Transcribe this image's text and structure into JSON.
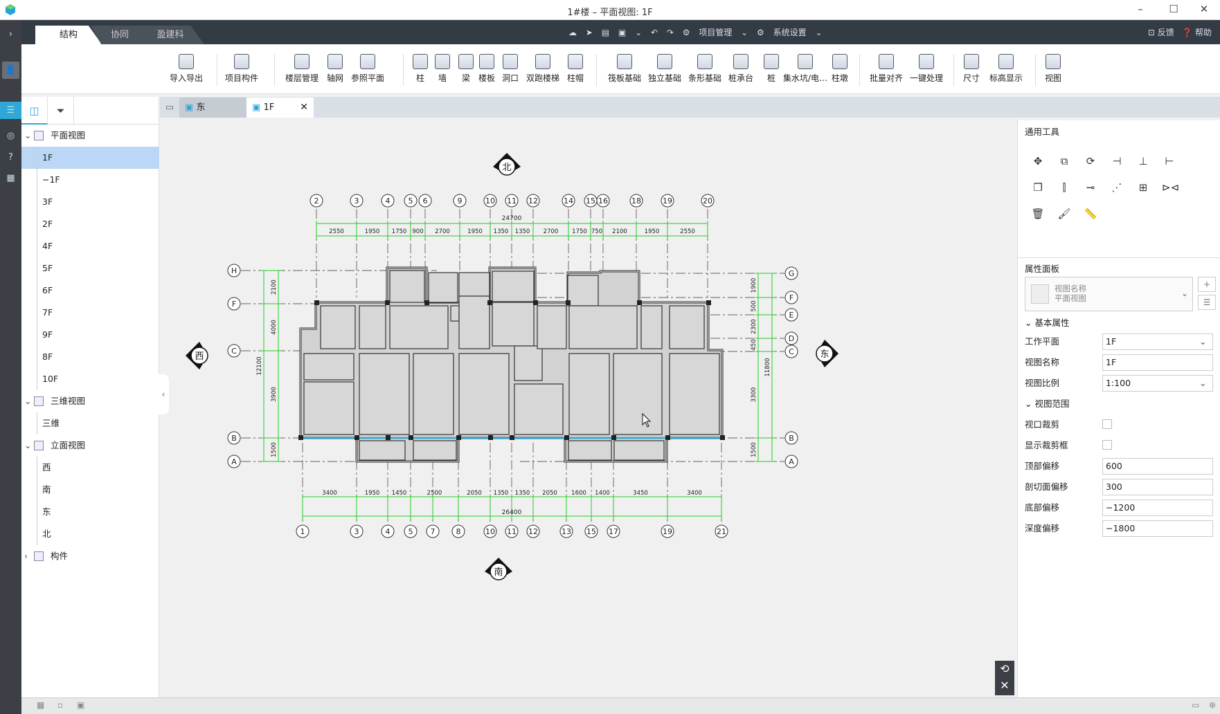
{
  "title": "1#楼 – 平面视图: 1F",
  "main_tabs": [
    "结构",
    "协同",
    "盈建科"
  ],
  "toolbar_center": [
    "项目管理",
    "系统设置"
  ],
  "toolbar_right": [
    "反馈",
    "帮助"
  ],
  "ribbon": [
    "导入导出",
    "项目构件",
    "楼层管理",
    "轴网",
    "参照平面",
    "柱",
    "墙",
    "梁",
    "楼板",
    "洞口",
    "双跑楼梯",
    "柱帽",
    "筏板基础",
    "独立基础",
    "条形基础",
    "桩承台",
    "桩",
    "集水坑/电…",
    "柱墩",
    "批量对齐",
    "一键处理",
    "尺寸",
    "标高显示",
    "视图"
  ],
  "tree": {
    "plan": "平面视图",
    "plan_items": [
      "1F",
      "−1F",
      "3F",
      "2F",
      "4F",
      "5F",
      "6F",
      "7F",
      "9F",
      "8F",
      "10F"
    ],
    "view3d": "三维视图",
    "view3d_items": [
      "三维"
    ],
    "elev": "立面视图",
    "elev_items": [
      "西",
      "南",
      "东",
      "北"
    ],
    "comp": "构件"
  },
  "view_tabs": [
    "东",
    "1F"
  ],
  "compass": {
    "north": "北",
    "south": "南",
    "west": "西",
    "east": "东"
  },
  "axes_top": [
    "2",
    "3",
    "4",
    "5",
    "6",
    "9",
    "10",
    "11",
    "12",
    "14",
    "15",
    "16",
    "18",
    "19",
    "20"
  ],
  "axes_bottom": [
    "1",
    "3",
    "4",
    "5",
    "7",
    "8",
    "10",
    "11",
    "12",
    "13",
    "15",
    "17",
    "19",
    "21"
  ],
  "axes_left": [
    "H",
    "F",
    "C",
    "B",
    "A"
  ],
  "axes_right": [
    "G",
    "F",
    "E",
    "D",
    "C",
    "B",
    "A"
  ],
  "dims_top_total": "24700",
  "dims_top": [
    "2550",
    "1950",
    "1750",
    "900",
    "2700",
    "1950",
    "1350",
    "1350",
    "2700",
    "1750",
    "750",
    "2100",
    "1950",
    "2550"
  ],
  "dims_bottom_total": "26400",
  "dims_bottom": [
    "3400",
    "1950",
    "1450",
    "2500",
    "2050",
    "1350",
    "1350",
    "2050",
    "1600",
    "1400",
    "3450",
    "3400"
  ],
  "dims_left_total": "12100",
  "dims_left": [
    "2100",
    "4000",
    "3900",
    "1500"
  ],
  "dims_right_total": "11800",
  "dims_right": [
    "1900",
    "500",
    "2300",
    "450",
    "3300",
    "1500"
  ],
  "right_panel": {
    "tools_title": "通用工具",
    "props_title": "属性面板",
    "view_name_hint": "视图名称",
    "view_type": "平面视图",
    "basic": "基本属性",
    "workplane_label": "工作平面",
    "workplane": "1F",
    "viewname_label": "视图名称",
    "viewname": "1F",
    "scale_label": "视图比例",
    "scale": "1:100",
    "range": "视图范围",
    "crop_label": "视口裁剪",
    "cropbox_label": "显示裁剪框",
    "top_label": "顶部偏移",
    "top": "600",
    "cut_label": "剖切面偏移",
    "cut": "300",
    "bottom_label": "底部偏移",
    "bottom": "−1200",
    "depth_label": "深度偏移",
    "depth": "−1800"
  },
  "colors": {
    "dark": "#333b44",
    "accent": "#2ea8d8",
    "dim": "#22cc22",
    "select": "#bcd7f5"
  }
}
